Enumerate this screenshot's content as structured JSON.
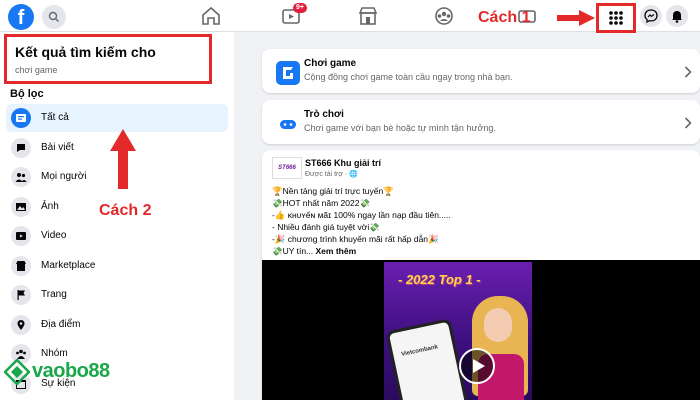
{
  "topbar": {
    "logo_letter": "f",
    "notification_count": "9+",
    "annotation_1": "Cách 1"
  },
  "sidebar": {
    "search_title": "Kết quả tìm kiếm cho",
    "search_query": "chơi game",
    "filter_label": "Bộ lọc",
    "annotation_2": "Cách 2",
    "items": [
      {
        "label": "Tất cả",
        "icon": "all-results-icon"
      },
      {
        "label": "Bài viết",
        "icon": "posts-icon"
      },
      {
        "label": "Mọi người",
        "icon": "people-icon"
      },
      {
        "label": "Ảnh",
        "icon": "photos-icon"
      },
      {
        "label": "Video",
        "icon": "video-icon"
      },
      {
        "label": "Marketplace",
        "icon": "marketplace-icon"
      },
      {
        "label": "Trang",
        "icon": "pages-icon"
      },
      {
        "label": "Địa điểm",
        "icon": "places-icon"
      },
      {
        "label": "Nhóm",
        "icon": "groups-icon"
      },
      {
        "label": "Sự kiện",
        "icon": "events-icon"
      }
    ]
  },
  "results": [
    {
      "title": "Chơi game",
      "description": "Cộng đồng chơi game toàn cầu ngay trong nhà bạn."
    },
    {
      "title": "Trò chơi",
      "description": "Chơi game với bạn bè hoặc tự mình tận hưởng."
    }
  ],
  "post": {
    "avatar_text": "ST666",
    "author": "ST666 Khu giải trí",
    "sponsored": "Được tài trợ",
    "lines": [
      "🏆Nền tảng giải trí trực tuyến🏆",
      "💸HOT nhất năm 2022💸",
      "-👍 ᴋʜᴜʏếɴ ᴍãɪ 100% ngay lần nạp đầu tiên.....",
      "- Nhiều đánh giá tuyệt vời💸",
      "-🎉 chương trình khuyến mãi rất hấp dẫn🎉",
      "💸UY tín..."
    ],
    "see_more": "Xem thêm",
    "media_caption": "2022 Top 1",
    "phone_brand": "Vietcombank"
  },
  "watermark": {
    "text": "vaobo88"
  },
  "colors": {
    "accent": "#1877f2",
    "annotation": "#e3292a",
    "watermark": "#1aa64a"
  }
}
